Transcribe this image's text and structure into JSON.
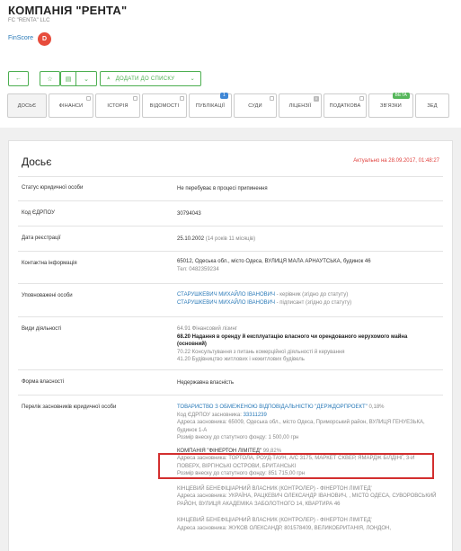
{
  "header": {
    "title": "КОМПАНІЯ \"РЕНТА\"",
    "subtitle": "FC \"RENTA\" LLC",
    "finscore_label": "FinScore",
    "finscore_grade": "D"
  },
  "toolbar": {
    "back_glyph": "←",
    "star_glyph": "☆",
    "doc_glyph": "▤",
    "arrow_glyph": "⌄",
    "add_icon": "⩓",
    "add_label": "ДОДАТИ ДО СПИСКУ"
  },
  "tabs": [
    {
      "label": "Досьє"
    },
    {
      "label": "Фінанси"
    },
    {
      "label": "Історія"
    },
    {
      "label": "Відомості"
    },
    {
      "label": "Публікації",
      "badge": "1"
    },
    {
      "label": "Суди"
    },
    {
      "label": "Ліцензії",
      "badge": "0"
    },
    {
      "label": "Податкова"
    },
    {
      "label": "Зв'язки",
      "badge": "beta"
    },
    {
      "label": "ЗЕД"
    }
  ],
  "dossier": {
    "title": "Досьє",
    "updated": "Актуально на 28.09.2017, 01:48:27",
    "status_label": "Статус юридичної особи",
    "status_value": "Не перебуває в процесі припинення",
    "edrpou_label": "Код ЄДРПОУ",
    "edrpou_value": "30794043",
    "reg_label": "Дата реєстрації",
    "reg_date": "25.10.2002",
    "reg_age": "(14 років 11 місяців)",
    "contact_label": "Контактна інформація",
    "contact_address": "65012, Одеська обл., місто Одеса, ВУЛИЦЯ МАЛА АРНАУТСЬКА, будинок 46",
    "contact_phone": "Тел: 0482359234",
    "persons_label": "Уповноважені особи",
    "person1_name": "СТАРУШКЕВИЧ МИХАЙЛО ІВАНОВИЧ",
    "person1_role": " - керівник (згідно до статуту)",
    "person2_name": "СТАРУШКЕВИЧ МИХАЙЛО ІВАНОВИЧ",
    "person2_role": " - підписант (згідно до статуту)",
    "activity_label": "Види діяльності",
    "activity1": "64.91 Фінансовий лізинг",
    "activity2": "68.20 Надання в оренду й експлуатацію власного чи орендованого нерухомого майна (основний)",
    "activity3": "70.22 Консультування з питань комерційної діяльності й керування",
    "activity4": "41.20 Будівництво житлових і нежитлових будівель",
    "ownership_label": "Форма власності",
    "ownership_value": "Недержавна власність",
    "founders_label": "Перелік засновників юридичної особи",
    "f1_name": "ТОВАРИСТВО З ОБМЕЖЕНОЮ ВІДПОВІДАЛЬНІСТЮ \"ДЕРЖДОРПРОЕКТ\"",
    "f1_share": " 0,18%",
    "f1_code_label": "Код ЄДРПОУ засновника: ",
    "f1_code": "33311239",
    "f1_address": "Адреса засновника: 65009, Одеська обл., місто Одеса, Приморський район, ВУЛИЦЯ ГЕНУЕЗЬКА, будинок 1-А",
    "f1_capital": "Розмір внеску до статутного фонду: 1 500,00 грн",
    "f2_name": "КОМПАНІЯ \"ФІНЕРТОН ЛІМІТЕД\"",
    "f2_share": " 99,82%",
    "f2_address": "Адреса засновника: ТОРТОЛА, РОУД-ТАУН, А/С 3175, МАРКЕТ СКВЕР, ЯМАРДЖ БІЛДІНГ, 3-Й ПОВЕРХ, ВІРГІНСЬКІ ОСТРОВИ, БРИТАНСЬКІ",
    "f2_capital": "Розмір внеску до статутного фонду: 851 715,00 грн",
    "b1_title": "КІНЦЕВИЙ БЕНЕФІЦІАРНИЙ ВЛАСНИК (КОНТРОЛЕР) - ФІНЕРТОН ЛІМІТЕД'",
    "b1_address": "Адреса засновника: УКРАЇНА, РАЦКЕВИЧ ОЛЕКСАНДР ІВАНОВИЧ, , МІСТО ОДЕСА, СУВОРОВСЬКИЙ РАЙОН, ВУЛИЦЯ АКАДЕМІКА ЗАБОЛОТНОГО 14, КВАРТИРА 46",
    "b2_title": "КІНЦЕВИЙ БЕНЕФІЦІАРНИЙ ВЛАСНИК (КОНТРОЛЕР) - ФІНЕРТОН ЛІМІТЕД'",
    "b2_address": "Адреса засновника: ЖУКОВ ОЛЕКСАНДР, 801578409, ВЕЛИКОБРИТАНІЯ, ЛОНДОН,"
  },
  "colors": {
    "accent_green": "#4caf50",
    "status_green": "#3b9b45",
    "link_blue": "#2a7ab8",
    "alert_red": "#e0413d",
    "highlight_red": "#d32f2f",
    "badge_red": "#e74c3c"
  },
  "icons": {
    "back": "arrow-left-icon",
    "star": "star-icon",
    "doc": "document-icon",
    "add": "list-add-icon",
    "chevron": "chevron-down-icon"
  }
}
